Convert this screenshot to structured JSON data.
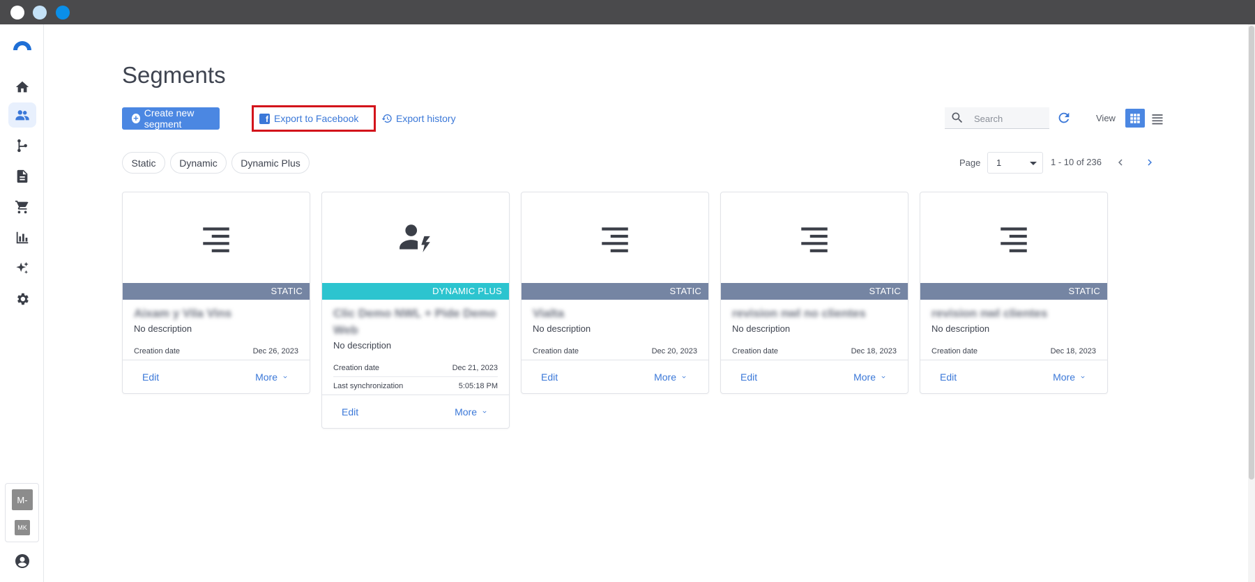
{
  "page": {
    "title": "Segments"
  },
  "toolbar": {
    "create_label": "Create new segment",
    "export_facebook_label": "Export to Facebook",
    "export_history_label": "Export history",
    "search_placeholder": "Search",
    "view_label": "View"
  },
  "filters": [
    "Static",
    "Dynamic",
    "Dynamic Plus"
  ],
  "pagination": {
    "label": "Page",
    "current": "1",
    "range": "1 - 10 of 236"
  },
  "account": {
    "initial": "M-",
    "short": "MK"
  },
  "colors": {
    "accent": "#4b87e2",
    "static_band": "#7585a3",
    "dynamic_plus_band": "#2cc4cf",
    "highlight_border": "#d3141b"
  },
  "segments": [
    {
      "name": "Aixam y Vila Vins",
      "type": "STATIC",
      "icon": "list-icon",
      "description": "No description",
      "meta": [
        {
          "label": "Creation date",
          "value": "Dec 26, 2023"
        }
      ],
      "edit": "Edit",
      "more": "More"
    },
    {
      "name": "Clic Demo NWL + Pide Demo Web",
      "type": "DYNAMIC PLUS",
      "icon": "person-bolt-icon",
      "description": "No description",
      "meta": [
        {
          "label": "Creation date",
          "value": "Dec 21, 2023"
        },
        {
          "label": "Last synchronization",
          "value": "5:05:18 PM"
        }
      ],
      "edit": "Edit",
      "more": "More"
    },
    {
      "name": "Vialta",
      "type": "STATIC",
      "icon": "list-icon",
      "description": "No description",
      "meta": [
        {
          "label": "Creation date",
          "value": "Dec 20, 2023"
        }
      ],
      "edit": "Edit",
      "more": "More"
    },
    {
      "name": "revision nwl no clientes",
      "type": "STATIC",
      "icon": "list-icon",
      "description": "No description",
      "meta": [
        {
          "label": "Creation date",
          "value": "Dec 18, 2023"
        }
      ],
      "edit": "Edit",
      "more": "More"
    },
    {
      "name": "revision nwl clientes",
      "type": "STATIC",
      "icon": "list-icon",
      "description": "No description",
      "meta": [
        {
          "label": "Creation date",
          "value": "Dec 18, 2023"
        }
      ],
      "edit": "Edit",
      "more": "More"
    }
  ]
}
